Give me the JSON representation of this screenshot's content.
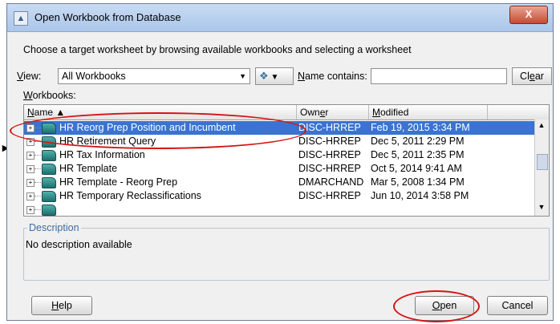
{
  "dialog": {
    "title": "Open Workbook from Database",
    "close_glyph": "X",
    "instruction": "Choose a target worksheet by browsing available workbooks and selecting a worksheet"
  },
  "filter": {
    "view_label_first": "V",
    "view_label_rest": "iew:",
    "view_value": "All Workbooks",
    "name_label_first": "N",
    "name_label_rest": "ame contains:",
    "name_value": "",
    "clear_pre": "Cl",
    "clear_u": "e",
    "clear_post": "ar"
  },
  "workbooks": {
    "label_first": "W",
    "label_rest": "orkbooks:",
    "columns": {
      "name_first": "N",
      "name_rest": "ame",
      "owner_pre": "Own",
      "owner_u": "e",
      "owner_post": "r",
      "modified_first": "M",
      "modified_rest": "odified"
    },
    "rows": [
      {
        "name": "HR Reorg Prep Position and Incumbent",
        "owner": "DISC-HRREP",
        "modified": "Feb 19, 2015 3:34 PM"
      },
      {
        "name": "HR Retirement Query",
        "owner": "DISC-HRREP",
        "modified": "Dec 5, 2011 2:29 PM"
      },
      {
        "name": "HR Tax Information",
        "owner": "DISC-HRREP",
        "modified": "Dec 5, 2011 2:35 PM"
      },
      {
        "name": "HR Template",
        "owner": "DISC-HRREP",
        "modified": "Oct 5, 2014 9:41 AM"
      },
      {
        "name": "HR Template - Reorg Prep",
        "owner": "DMARCHAND",
        "modified": "Mar 5, 2008 1:34 PM"
      },
      {
        "name": "HR Temporary Reclassifications",
        "owner": "DISC-HRREP",
        "modified": "Jun 10, 2014 3:58 PM"
      }
    ]
  },
  "description": {
    "legend": "Description",
    "text": "No description available"
  },
  "buttons": {
    "help_first": "H",
    "help_rest": "elp",
    "open_first": "O",
    "open_rest": "pen",
    "cancel": "Cancel"
  },
  "colors": {
    "selection": "#3a73d0",
    "callout": "#d41414"
  }
}
